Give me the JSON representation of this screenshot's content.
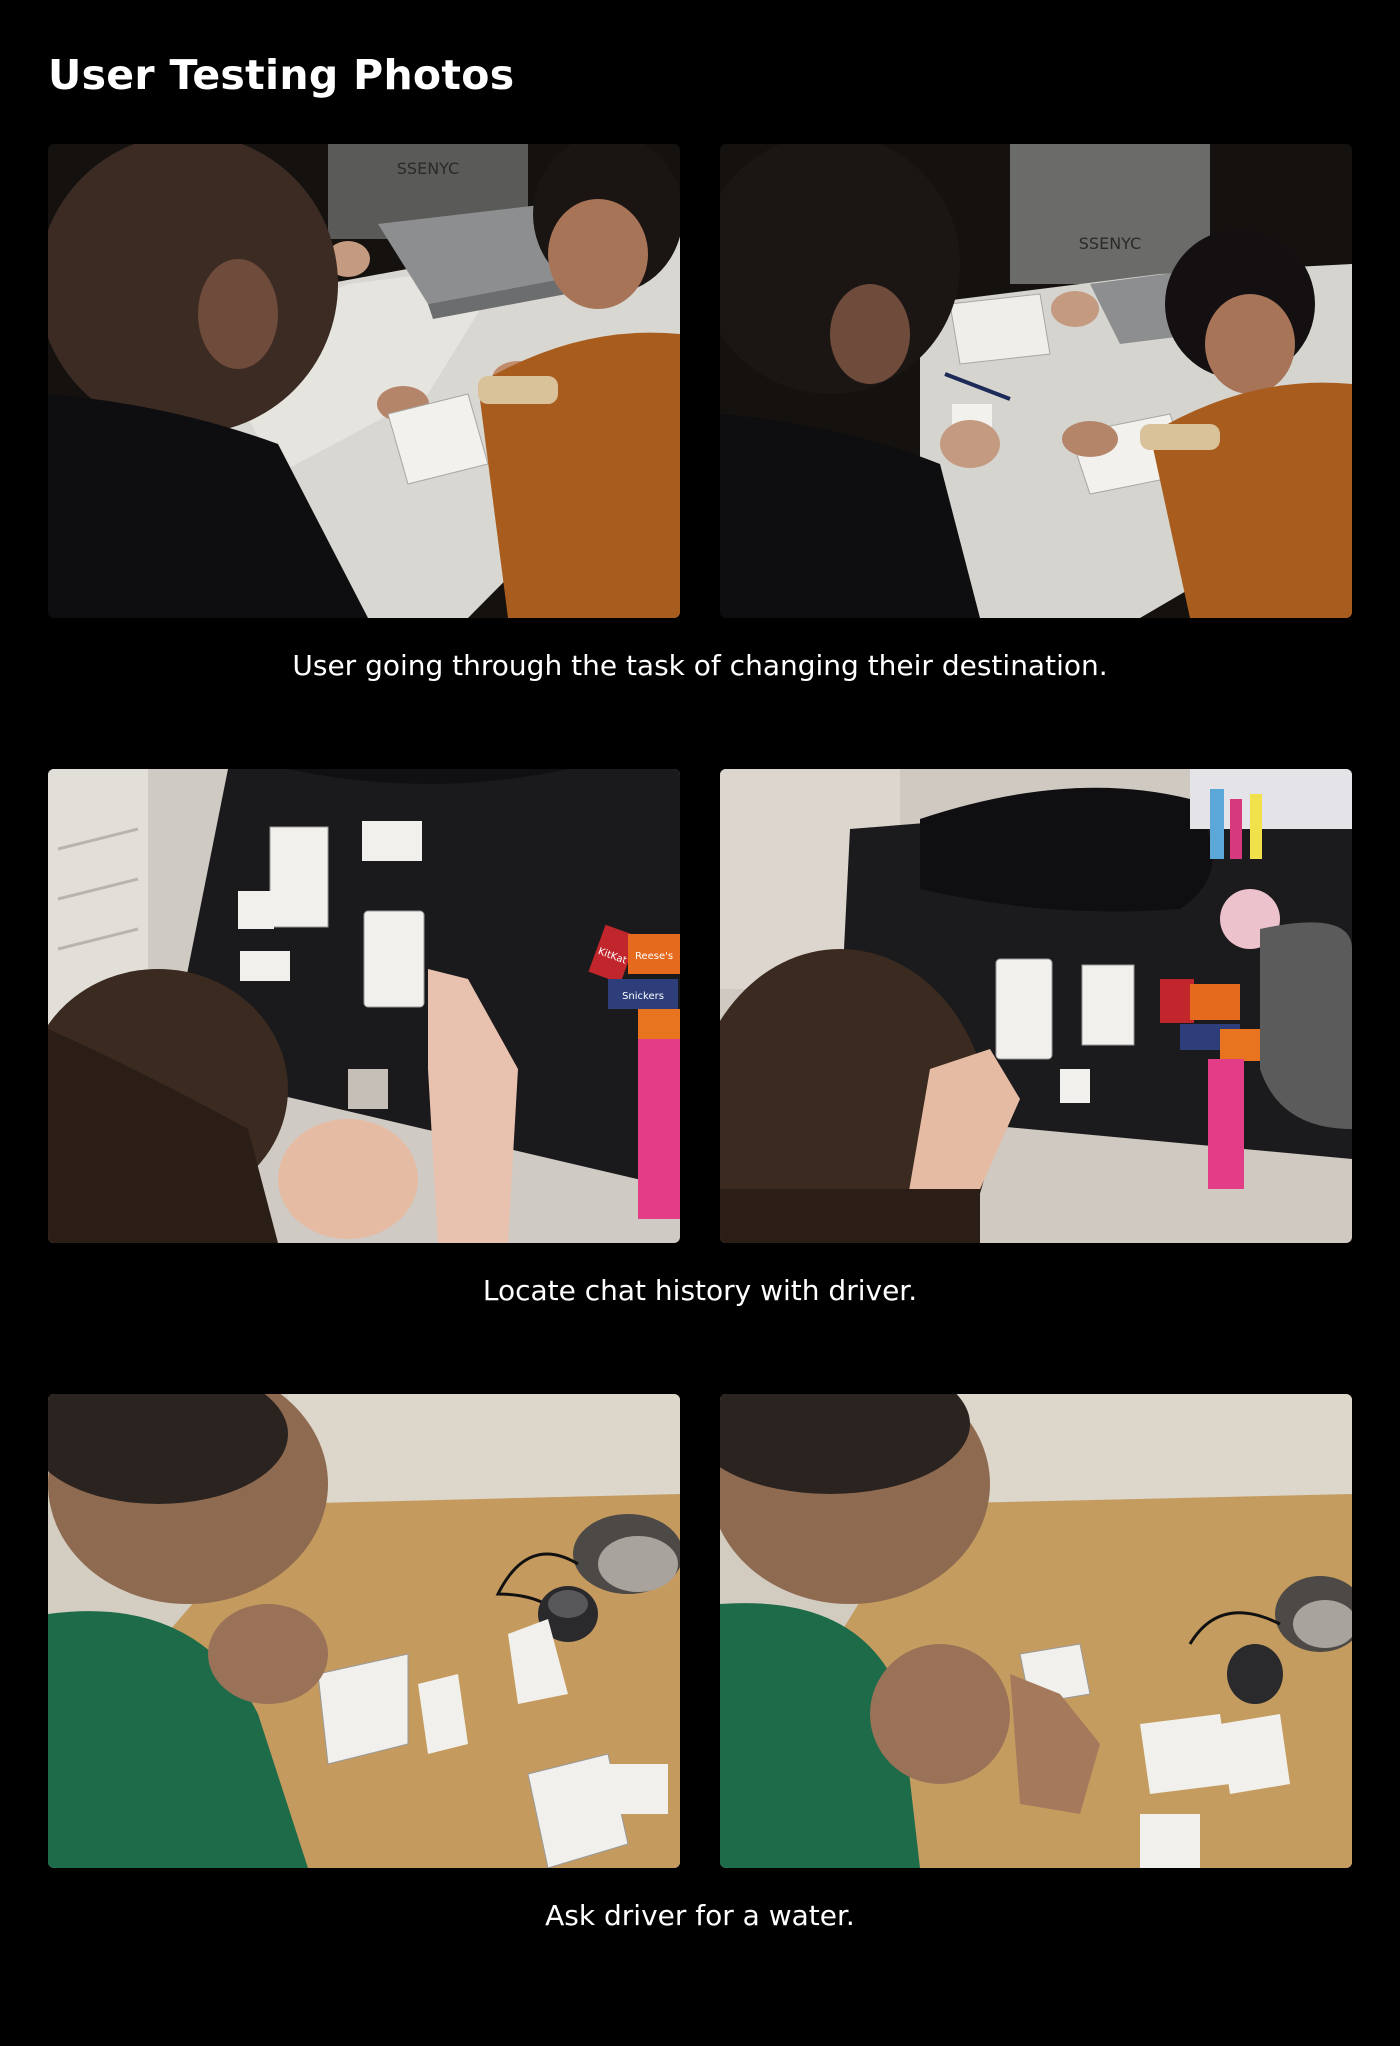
{
  "page": {
    "title": "User Testing Photos"
  },
  "sections": [
    {
      "caption": "User going through the task of changing their destination.",
      "photos": [
        "user-testing-photo-1a",
        "user-testing-photo-1b"
      ]
    },
    {
      "caption": "Locate chat history with driver.",
      "photos": [
        "user-testing-photo-2a",
        "user-testing-photo-2b"
      ]
    },
    {
      "caption": "Ask driver for a water.",
      "photos": [
        "user-testing-photo-3a",
        "user-testing-photo-3b"
      ]
    }
  ],
  "photo_text": {
    "hoodie_print": "SSENYC",
    "candy_1": "KitKat",
    "candy_2": "Reese's",
    "candy_3": "Snickers"
  },
  "colors": {
    "background": "#000000",
    "text": "#ffffff"
  }
}
